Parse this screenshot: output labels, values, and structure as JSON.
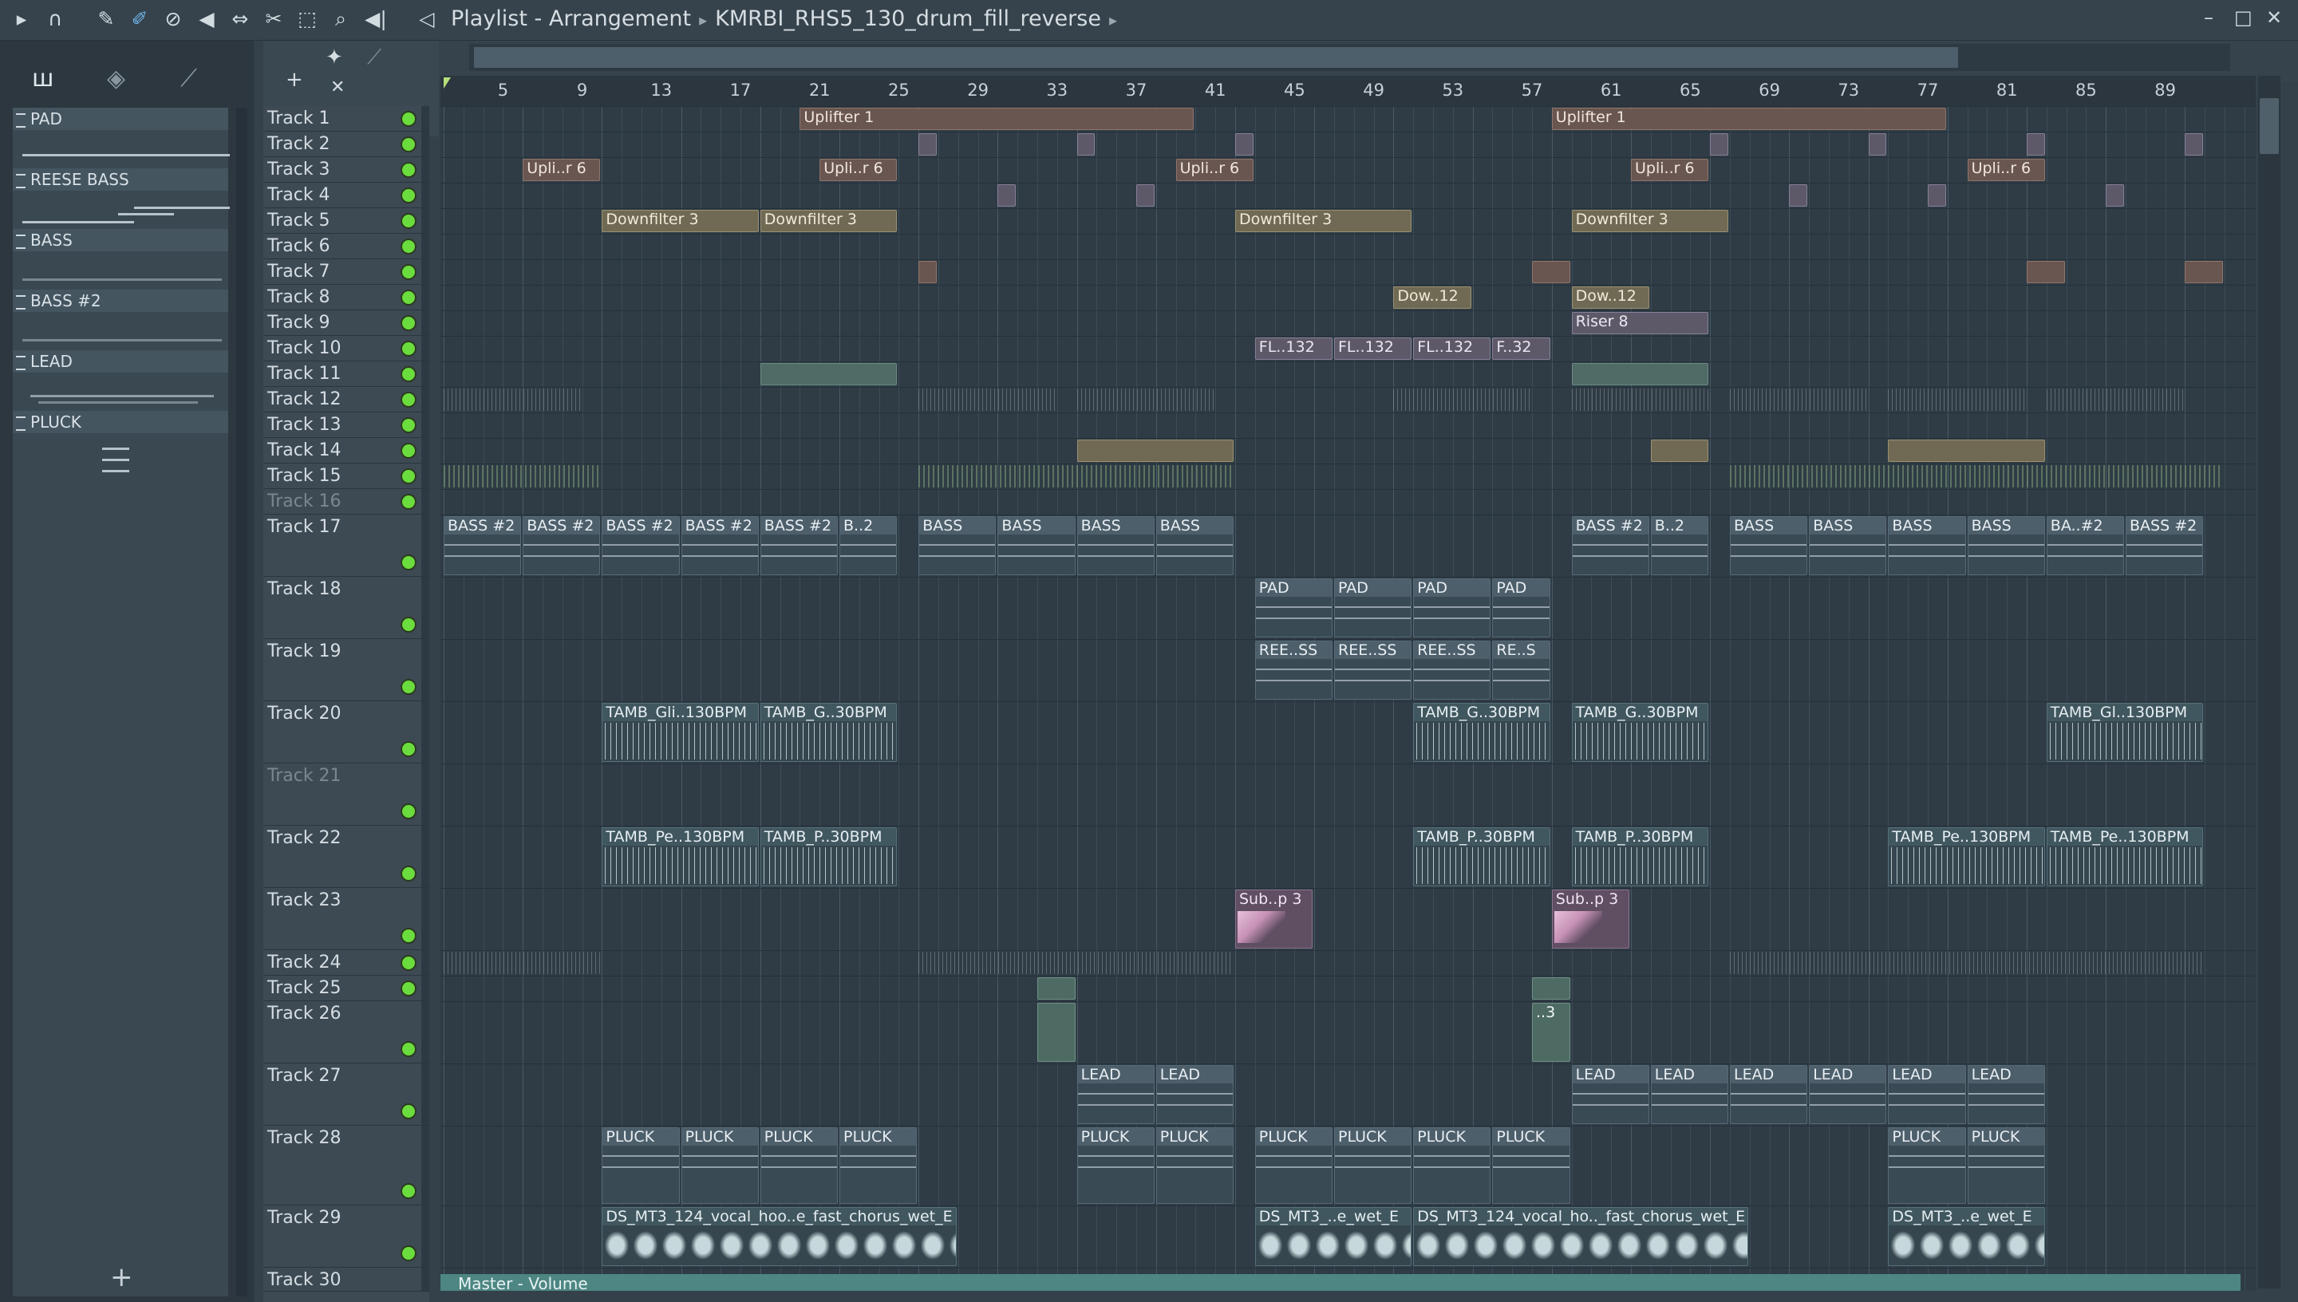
{
  "window": {
    "title": "Playlist - Arrangement",
    "breadcrumb_file": "KMRBI_RHS5_130_drum_fill_reverse",
    "controls": {
      "minimize": "–",
      "maximize": "□",
      "close": "✕"
    }
  },
  "toolbar": {
    "icons": [
      "play-arrow-icon",
      "magnet-icon",
      "pencil-icon",
      "paint-brush-icon",
      "delete-icon",
      "mute-icon",
      "slip-icon",
      "slice-icon",
      "select-icon",
      "zoom-icon",
      "playback-icon"
    ],
    "glyphs": {
      "play": "▸",
      "magnet": "∩",
      "pencil": "✎",
      "paint": "✐",
      "delete": "⊘",
      "mute": "◀",
      "slip": "⇔",
      "slice": "✂",
      "select": "⬚",
      "zoom": "⌕",
      "playback": "◀|",
      "speaker": "◁"
    }
  },
  "left_panel": {
    "tab_icons": {
      "piano": "ш",
      "wave": "◈",
      "link": "⟋"
    },
    "add_label": "+",
    "patterns": [
      {
        "name": "PAD"
      },
      {
        "name": "REESE BASS"
      },
      {
        "name": "BASS"
      },
      {
        "name": "BASS #2"
      },
      {
        "name": "LEAD"
      },
      {
        "name": "PLUCK"
      }
    ]
  },
  "header_tools": {
    "add": "+",
    "delete": "✕",
    "snap": "✦",
    "link": "⟋"
  },
  "ruler": {
    "labels": [
      "5",
      "9",
      "13",
      "17",
      "21",
      "25",
      "29",
      "33",
      "37",
      "41",
      "45",
      "49",
      "53",
      "57",
      "61",
      "65",
      "69",
      "73",
      "77",
      "81",
      "85",
      "89"
    ]
  },
  "tracks": [
    "Track 1",
    "Track 2",
    "Track 3",
    "Track 4",
    "Track 5",
    "Track 6",
    "Track 7",
    "Track 8",
    "Track 9",
    "Track 10",
    "Track 11",
    "Track 12",
    "Track 13",
    "Track 14",
    "Track 15",
    "Track 16",
    "Track 17",
    "Track 18",
    "Track 19",
    "Track 20",
    "Track 21",
    "Track 22",
    "Track 23",
    "Track 24",
    "Track 25",
    "Track 26",
    "Track 27",
    "Track 28",
    "Track 29",
    "Track 30"
  ],
  "clips": {
    "uplifter_a": "Uplifter 1",
    "uplifter_b": "Uplifter 1",
    "upli_1": "Upli..r 6",
    "upli_2": "Upli..r 6",
    "upli_3": "Upli..r 6",
    "upli_4": "Upli..r 6",
    "upli_5": "Upli..r 6",
    "downfilter_1": "Downfilter 3",
    "downfilter_2": "Downfilter 3",
    "downfilter_3": "Downfilter 3",
    "downfilter_4": "Downfilter 3",
    "dow_1": "Dow..12",
    "dow_2": "Dow..12",
    "riser": "Riser 8",
    "fl_1": "FL..132",
    "fl_2": "FL..132",
    "fl_3": "FL..132",
    "fl_4": "F..32",
    "bass2_1": "BASS #2",
    "bass2_2": "BASS #2",
    "bass2_3": "BASS #2",
    "bass2_4": "BASS #2",
    "bass2_5": "BASS #2",
    "b2_short": "B..2",
    "bass_1": "BASS",
    "bass_2": "BASS",
    "bass_3": "BASS",
    "bass_4": "BASS",
    "bass2_6": "BASS #2",
    "b2_short2": "B..2",
    "bass_5": "BASS",
    "bass_6": "BASS",
    "bass_7": "BASS",
    "bass_8": "BASS",
    "ba2": "BA..#2",
    "bass2_7": "BASS #2",
    "pad_1": "PAD",
    "pad_2": "PAD",
    "pad_3": "PAD",
    "pad_4": "PAD",
    "ree_1": "REE..SS",
    "ree_2": "REE..SS",
    "ree_3": "REE..SS",
    "ree_4": "RE..S",
    "tamb_gl_1": "TAMB_Gli..130BPM",
    "tamb_gl_2": "TAMB_G..30BPM",
    "tamb_gl_3": "TAMB_G..30BPM",
    "tamb_gl_4": "TAMB_G..30BPM",
    "tamb_gl_5": "TAMB_Gl..130BPM",
    "tamb_pe_1": "TAMB_Pe..130BPM",
    "tamb_pe_2": "TAMB_P..30BPM",
    "tamb_pe_3": "TAMB_P..30BPM",
    "tamb_pe_4": "TAMB_P..30BPM",
    "tamb_pe_5": "TAMB_Pe..130BPM",
    "tamb_pe_6": "TAMB_Pe..130BPM",
    "sub_1": "Sub..p 3",
    "sub_2": "Sub..p 3",
    "fx_short": "..3",
    "lead_1": "LEAD",
    "lead_2": "LEAD",
    "lead_3": "LEAD",
    "lead_4": "LEAD",
    "lead_5": "LEAD",
    "lead_6": "LEAD",
    "lead_7": "LEAD",
    "lead_8": "LEAD",
    "pluck_1": "PLUCK",
    "pluck_2": "PLUCK",
    "pluck_3": "PLUCK",
    "pluck_4": "PLUCK",
    "pluck_5": "PLUCK",
    "pluck_6": "PLUCK",
    "pluck_7": "PLUCK",
    "pluck_8": "PLUCK",
    "pluck_9": "PLUCK",
    "pluck_10": "PLUCK",
    "pluck_11": "PLUCK",
    "pluck_12": "PLUCK",
    "vocal_1": "DS_MT3_124_vocal_hoo..e_fast_chorus_wet_E",
    "vocal_2": "DS_MT3_..e_wet_E",
    "vocal_3": "DS_MT3_124_vocal_ho.._fast_chorus_wet_E",
    "vocal_4": "DS_MT3_..e_wet_E",
    "master": "Master - Volume"
  },
  "colors": {
    "track_led": "#6bdc3d",
    "automation_clip": "#6a5650",
    "audio_clip": "#35464f",
    "master_lane": "#4d8683"
  }
}
